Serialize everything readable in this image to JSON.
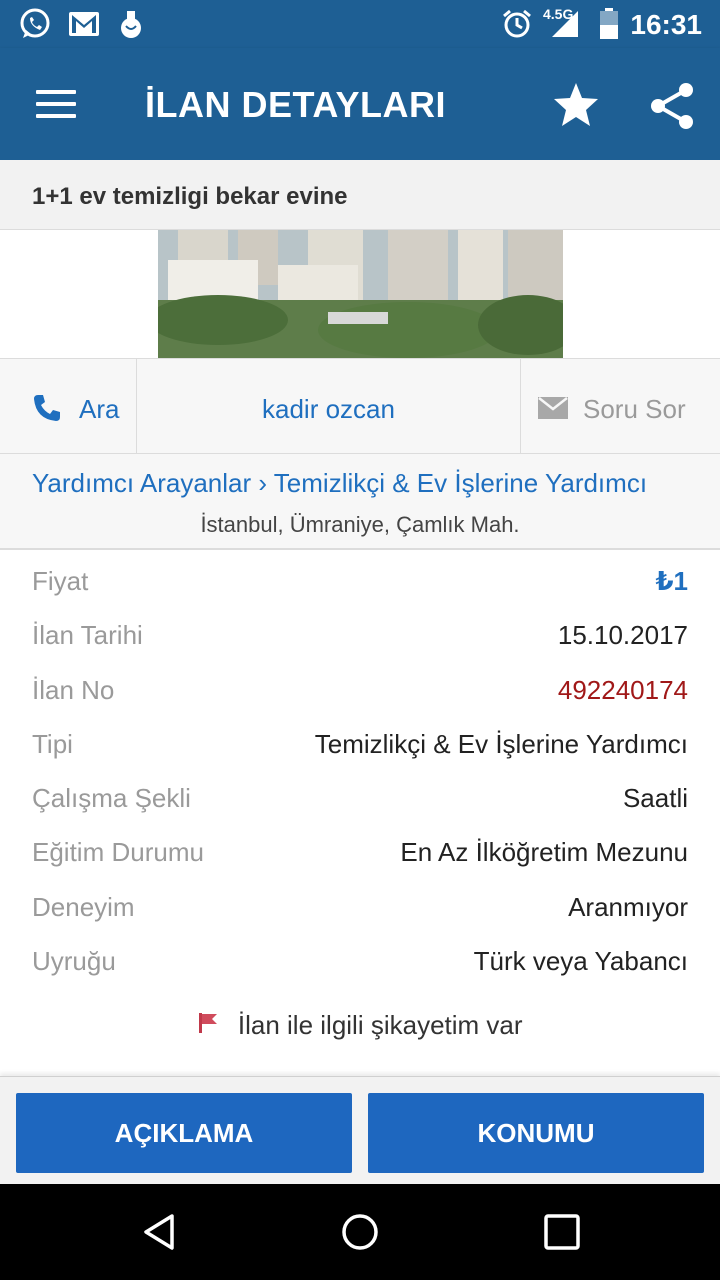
{
  "status_bar": {
    "time": "16:31",
    "network": "4.5G",
    "icons": [
      "whatsapp-icon",
      "gmail-icon",
      "notification-icon",
      "alarm-icon",
      "signal-icon",
      "battery-icon"
    ]
  },
  "app_bar": {
    "title": "İLAN DETAYLARI",
    "icons": [
      "menu-icon",
      "star-icon",
      "share-icon"
    ]
  },
  "listing": {
    "title": "1+1 ev temizligi bekar evine"
  },
  "actions": {
    "call_label": "Ara",
    "owner_name": "kadir ozcan",
    "ask_label": "Soru Sor"
  },
  "category": {
    "breadcrumb": "Yardımcı Arayanlar › Temizlikçi & Ev İşlerine Yardımcı",
    "location": "İstanbul, Ümraniye, Çamlık Mah."
  },
  "details": [
    {
      "label": "Fiyat",
      "value": "₺1",
      "color": "#1f6fbf",
      "bold": true
    },
    {
      "label": "İlan Tarihi",
      "value": "15.10.2017",
      "color": "#222222",
      "bold": false
    },
    {
      "label": "İlan No",
      "value": "492240174",
      "color": "#a01818",
      "bold": false
    },
    {
      "label": "Tipi",
      "value": "Temizlikçi & Ev İşlerine Yardımcı",
      "color": "#222222",
      "bold": false
    },
    {
      "label": "Çalışma Şekli",
      "value": "Saatli",
      "color": "#222222",
      "bold": false
    },
    {
      "label": "Eğitim Durumu",
      "value": "En Az İlköğretim Mezunu",
      "color": "#222222",
      "bold": false
    },
    {
      "label": "Deneyim",
      "value": "Aranmıyor",
      "color": "#222222",
      "bold": false
    },
    {
      "label": "Uyruğu",
      "value": "Türk veya Yabancı",
      "color": "#222222",
      "bold": false
    }
  ],
  "complaint_label": "İlan ile ilgili şikayetim var",
  "buttons": {
    "description": "AÇIKLAMA",
    "location": "KONUMU"
  },
  "colors": {
    "primary": "#1e5f94",
    "button": "#1e67bf",
    "link": "#1f6fbf",
    "listing_no": "#a01818"
  }
}
